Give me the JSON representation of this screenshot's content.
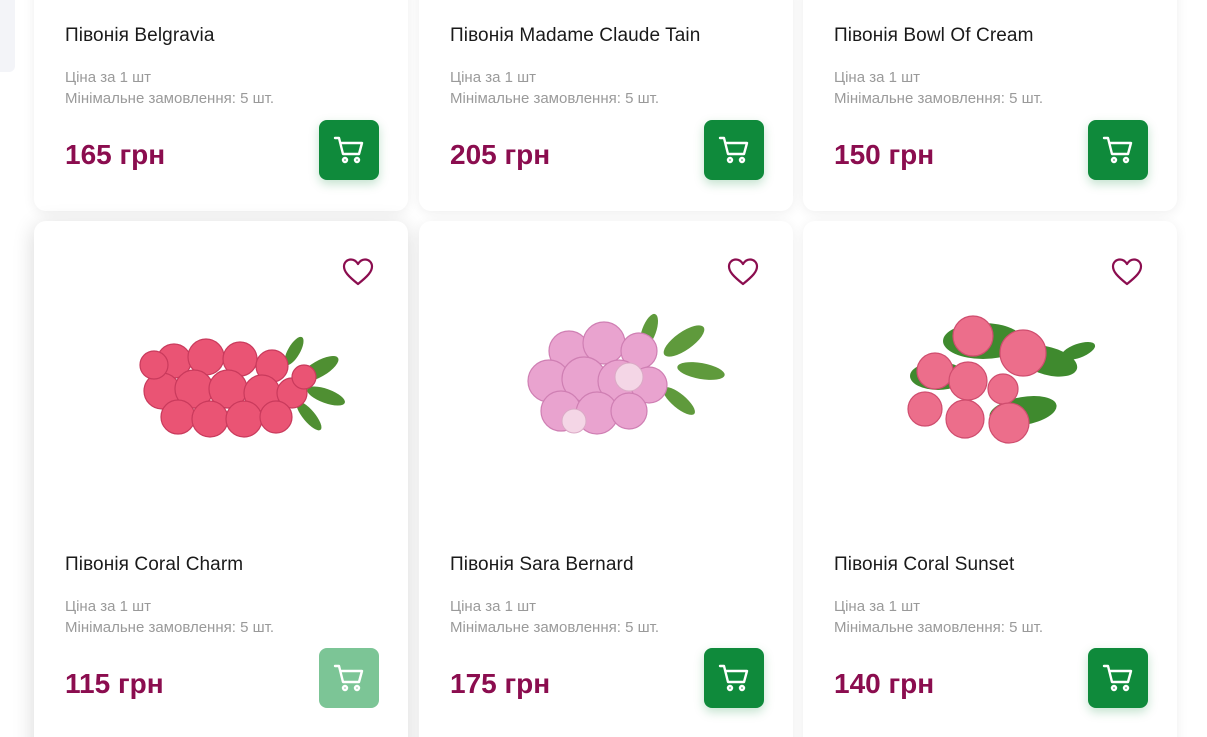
{
  "products": [
    {
      "title": "Півонія Belgravia",
      "price_note": "Ціна за 1 шт",
      "min_order": "Мінімальне замовлення: 5 шт.",
      "price": "165 грн"
    },
    {
      "title": "Півонія Madame Claude Tain",
      "price_note": "Ціна за 1 шт",
      "min_order": "Мінімальне замовлення: 5 шт.",
      "price": "205 грн"
    },
    {
      "title": "Півонія Bowl Of Cream",
      "price_note": "Ціна за 1 шт",
      "min_order": "Мінімальне замовлення: 5 шт.",
      "price": "150 грн"
    },
    {
      "title": "Півонія Coral Charm",
      "price_note": "Ціна за 1 шт",
      "min_order": "Мінімальне замовлення: 5 шт.",
      "price": "115 грн"
    },
    {
      "title": "Півонія Sara Bernard",
      "price_note": "Ціна за 1 шт",
      "min_order": "Мінімальне замовлення: 5 шт.",
      "price": "175 грн"
    },
    {
      "title": "Півонія Coral Sunset",
      "price_note": "Ціна за 1 шт",
      "min_order": "Мінімальне замовлення: 5 шт.",
      "price": "140 грн"
    }
  ],
  "icons": {
    "cart": "shopping-cart-icon",
    "favorite": "heart-icon"
  },
  "colors": {
    "price": "#8b0d4f",
    "cart_button": "#0f8a3b",
    "cart_button_hover": "#7cc596",
    "heart": "#8b0d4f"
  }
}
